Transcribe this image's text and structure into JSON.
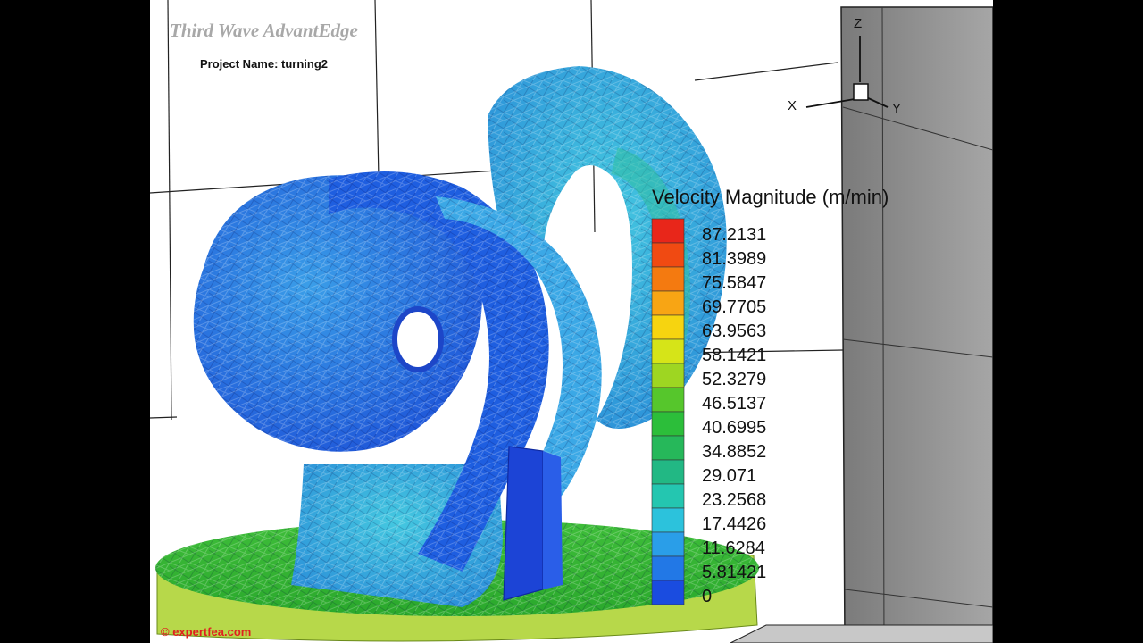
{
  "header": {
    "app_title": "Third Wave AdvantEdge",
    "project_label": "Project Name: turning2"
  },
  "legend": {
    "title": "Velocity Magnitude (m/min)",
    "ticks": [
      "87.2131",
      "81.3989",
      "75.5847",
      "69.7705",
      "63.9563",
      "58.1421",
      "52.3279",
      "46.5137",
      "40.6995",
      "34.8852",
      "29.071",
      "23.2568",
      "17.4426",
      "11.6284",
      "5.81421",
      "0"
    ],
    "colors": [
      "#e8261a",
      "#f04a12",
      "#f47a10",
      "#f8a514",
      "#f6d410",
      "#d6e418",
      "#9ed622",
      "#56c62c",
      "#2cbe3a",
      "#26b85a",
      "#22b884",
      "#24c6b0",
      "#2cc2dc",
      "#2a9ee8",
      "#2278e6",
      "#1a4ce0"
    ]
  },
  "axes": {
    "x_label": "X",
    "y_label": "Y",
    "z_label": "Z"
  },
  "watermark": "© expertfea.com"
}
